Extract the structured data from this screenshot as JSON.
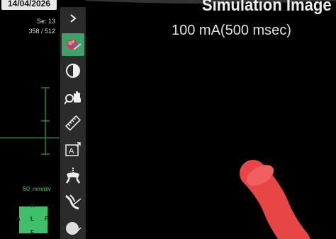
{
  "left_panel": {
    "date": "14/04/2026",
    "series": "Se: 13",
    "image_index": "358 / 512",
    "scale_value": "50",
    "scale_unit": "mm/div",
    "orientation": {
      "top": "H",
      "left": "A",
      "center": "L",
      "right": "P",
      "bottom": "F"
    }
  },
  "toolbar": {
    "items": [
      {
        "name": "collapse",
        "icon": "chevron-right-icon",
        "active": false
      },
      {
        "name": "3d-view",
        "icon": "organ-3d-icon",
        "active": true
      },
      {
        "name": "window-level",
        "icon": "contrast-icon",
        "active": false
      },
      {
        "name": "zoom-pan",
        "icon": "zoom-hand-icon",
        "active": false
      },
      {
        "name": "measure",
        "icon": "ruler-icon",
        "active": false
      },
      {
        "name": "annotate",
        "icon": "text-annotation-icon",
        "active": false
      },
      {
        "name": "skeleton",
        "icon": "skeleton-icon",
        "active": false
      },
      {
        "name": "vessel",
        "icon": "vessel-cut-icon",
        "active": false
      },
      {
        "name": "sphere",
        "icon": "sphere-icon",
        "active": false
      }
    ]
  },
  "main": {
    "title": "Simulation Image",
    "subtitle": "100 mA(500 msec)",
    "vessel_color": "#e84545"
  }
}
